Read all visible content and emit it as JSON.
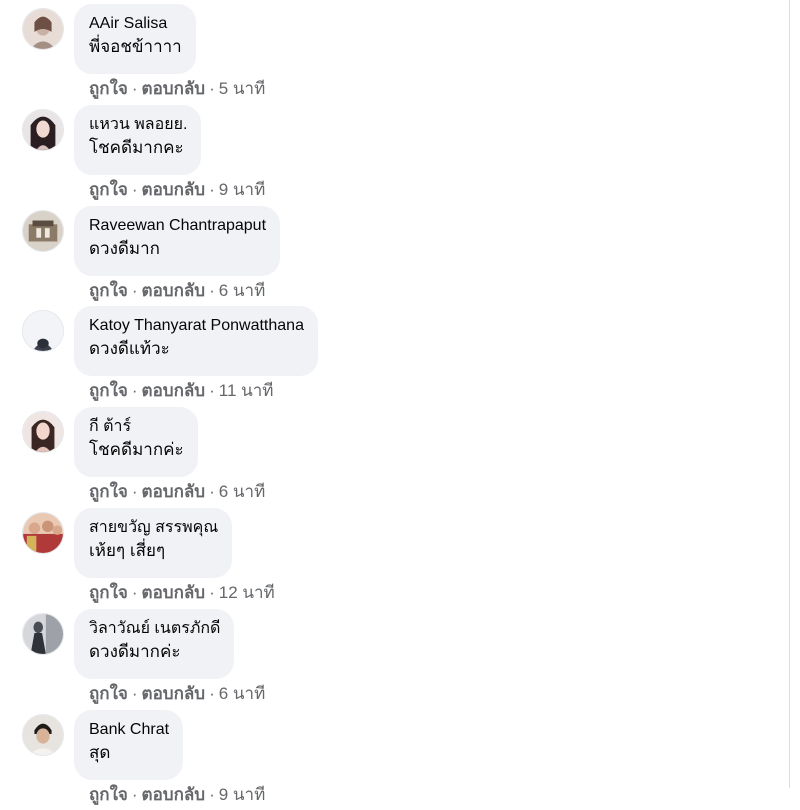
{
  "actions": {
    "like": "ถูกใจ",
    "reply": "ตอบกลับ",
    "separator": "·"
  },
  "comments": [
    {
      "author": "AAir Salisa",
      "text": "พี่จอชข้าาาา",
      "time": "5 นาที",
      "avatar_color": "#c9b1a6"
    },
    {
      "author": "แหวน พลอยย.",
      "text": "โชคดีมากคะ",
      "time": "9 นาที",
      "avatar_color": "#3b2a2e"
    },
    {
      "author": "Raveewan Chantrapaput",
      "text": "ดวงดีมาก",
      "time": "6 นาที",
      "avatar_color": "#8a7a66"
    },
    {
      "author": "Katoy Thanyarat Ponwatthana",
      "text": "ดวงดีแท้วะ",
      "time": "11 นาที",
      "avatar_color": "#d8dde3"
    },
    {
      "author": "กี ต้าร์",
      "text": "โชคดีมากค่ะ",
      "time": "6 นาที",
      "avatar_color": "#5a3f3a"
    },
    {
      "author": "สายขวัญ สรรพคุณ",
      "text": "เห้ยๆ เสี่ยๆ",
      "time": "12 นาที",
      "avatar_color": "#b03a3a"
    },
    {
      "author": "วิลาวัณย์ เนตรภักดี",
      "text": "ดวงดีมากค่ะ",
      "time": "6 นาที",
      "avatar_color": "#6b6e75"
    },
    {
      "author": "Bank Chrat",
      "text": "สุด",
      "time": "9 นาที",
      "avatar_color": "#2f2a28"
    }
  ]
}
